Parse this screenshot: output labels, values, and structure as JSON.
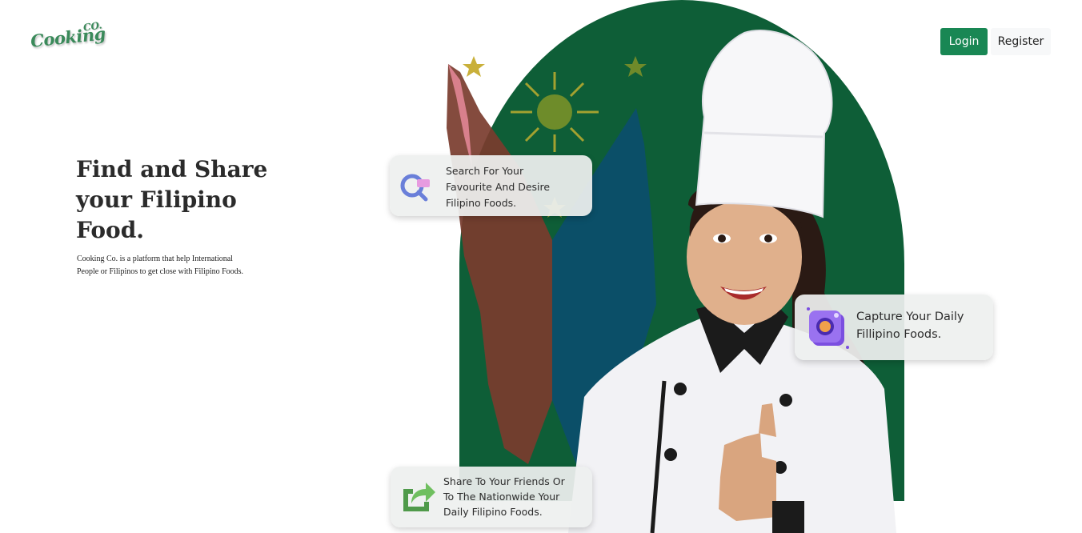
{
  "brand": {
    "logo_main": "Cooking",
    "logo_suffix": "CO."
  },
  "nav": {
    "login_label": "Login",
    "register_label": "Register"
  },
  "hero": {
    "title_line1": "Find and Share",
    "title_line2": "your Filipino",
    "title_line3": "Food.",
    "subtitle_line1": "Cooking Co. is a platform that help International",
    "subtitle_line2": "People or Filipinos to get close with Filipino Foods."
  },
  "features": [
    {
      "icon": "magnifier-icon",
      "lines": [
        "Search For Your",
        "Favourite And Desire",
        "Filipino Foods."
      ]
    },
    {
      "icon": "camera-icon",
      "lines": [
        "Capture Your Daily",
        "Fillipino Foods."
      ]
    },
    {
      "icon": "share-icon",
      "lines": [
        "Share To Your Friends Or",
        "To The Nationwide Your",
        "Daily Filipino Foods."
      ]
    }
  ],
  "colors": {
    "primary": "#198754",
    "arch_green": "#0e5e37",
    "text_dark": "#2b2b2b"
  }
}
